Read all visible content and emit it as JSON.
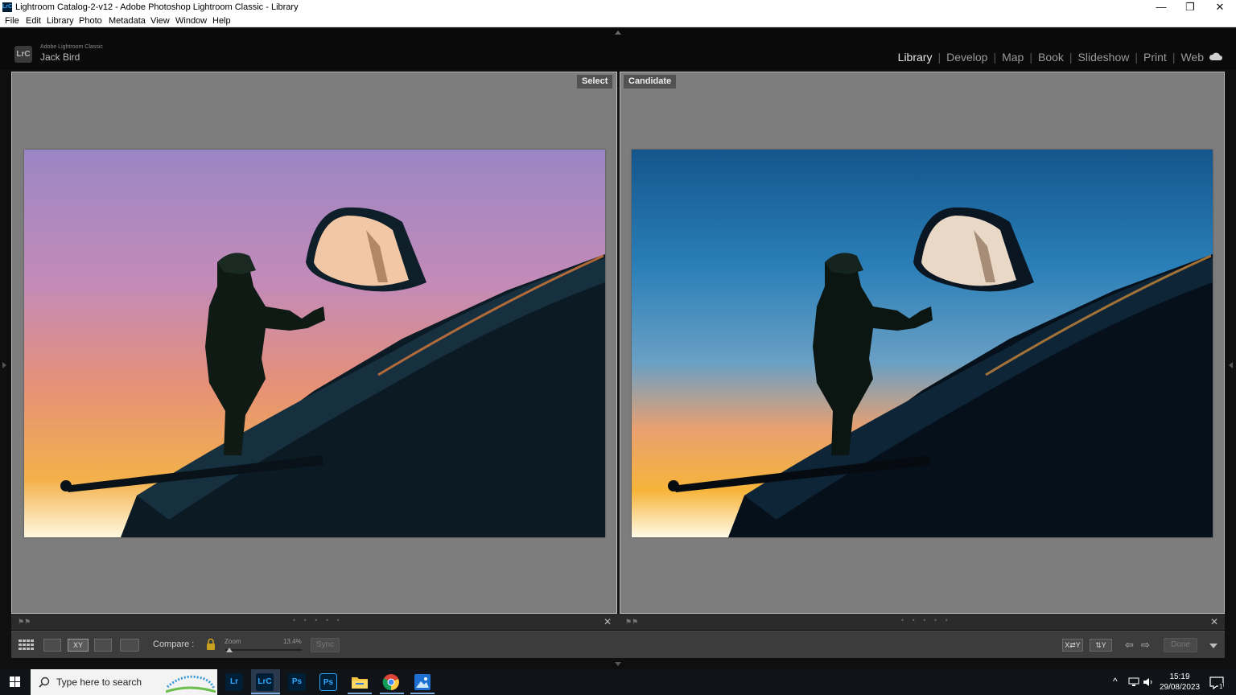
{
  "window": {
    "title": "Lightroom Catalog-2-v12 - Adobe Photoshop Lightroom Classic - Library",
    "app_icon": "LrC",
    "controls": [
      "minimize-icon",
      "restore-icon",
      "close-icon"
    ],
    "min_glyph": "—",
    "restore_glyph": "❐",
    "close_glyph": "✕"
  },
  "menu": [
    "File",
    "Edit",
    "Library",
    "Photo",
    "Metadata",
    "View",
    "Window",
    "Help"
  ],
  "header": {
    "logo": "LrC",
    "brand": "Adobe Lightroom Classic",
    "user": "Jack Bird",
    "modules": [
      "Library",
      "Develop",
      "Map",
      "Book",
      "Slideshow",
      "Print",
      "Web"
    ],
    "active_module": "Library",
    "sep": "|"
  },
  "compare": {
    "left_label": "Select",
    "right_label": "Candidate"
  },
  "subbar": {
    "close_glyph": "✕",
    "dots": "• • • • •"
  },
  "toolbar": {
    "compare_label": "Compare :",
    "zoom_label": "Zoom",
    "zoom_value": "13.4%",
    "zoom_fraction": 0.05,
    "sync_label": "Sync",
    "done_label": "Done",
    "xy_label": "XY",
    "swap_label": "X⇄Y",
    "make_select_label": "⇅Y"
  },
  "taskbar": {
    "search_placeholder": "Type here to search",
    "apps": [
      {
        "label": "Lr",
        "bg": "#001e36",
        "fg": "#31a8ff"
      },
      {
        "label": "LrC",
        "bg": "#001e36",
        "fg": "#31a8ff"
      },
      {
        "label": "Ps",
        "bg": "#001e36",
        "fg": "#31a8ff"
      },
      {
        "label": "Ps",
        "bg": "#001e36",
        "fg": "#31a8ff"
      }
    ],
    "time": "15:19",
    "date": "29/08/2023",
    "notification_count": "1"
  },
  "colors": {
    "accent": "#31a8ff",
    "pane_bg": "#7d7d7d"
  }
}
